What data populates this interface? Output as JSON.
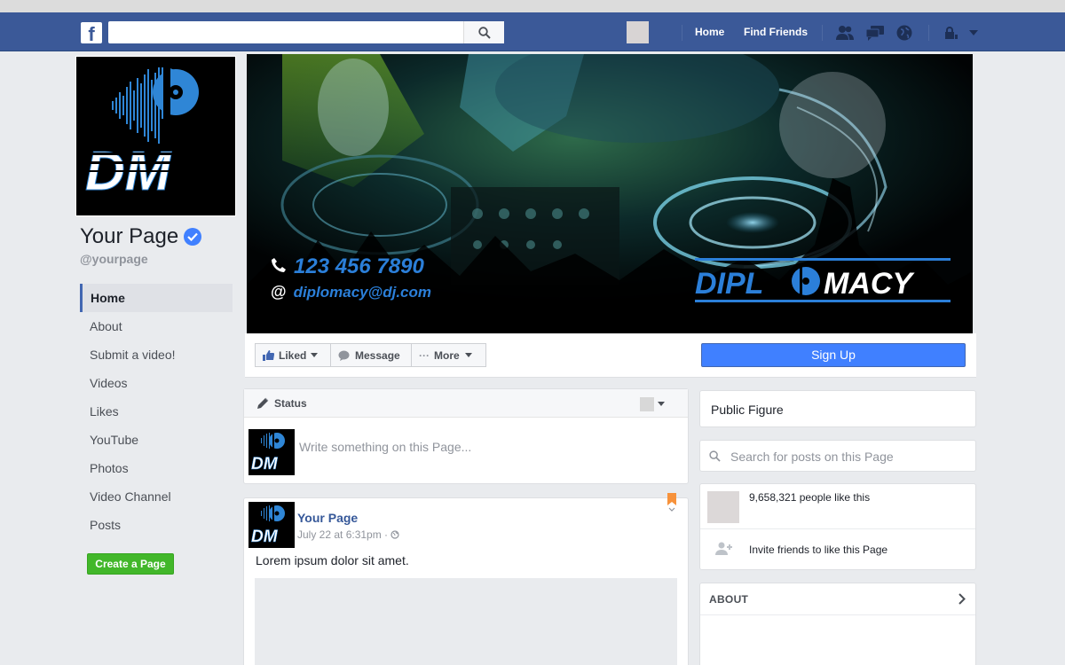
{
  "header": {
    "logo_letter": "f",
    "search_placeholder": "",
    "nav": [
      "Home",
      "Find Friends"
    ]
  },
  "page": {
    "name": "Your Page",
    "handle": "@yourpage"
  },
  "profile_logo": {
    "text": "DM"
  },
  "side_nav": [
    "Home",
    "About",
    "Submit a video!",
    "Videos",
    "Likes",
    "YouTube",
    "Photos",
    "Video Channel",
    "Posts"
  ],
  "create_page": "Create a Page",
  "cover": {
    "phone": "123 456 7890",
    "email": "diplomacy@dj.com",
    "brand_left": "DIPL",
    "brand_right": "MACY"
  },
  "actions": {
    "liked": "Liked",
    "message": "Message",
    "more": "More",
    "signup": "Sign Up"
  },
  "composer": {
    "status": "Status",
    "placeholder": "Write something on this Page..."
  },
  "post": {
    "author": "Your Page",
    "date": "July 22 at 6:31pm · ",
    "text": "Lorem ipsum dolor sit amet."
  },
  "right": {
    "category": "Public Figure",
    "search_placeholder": "Search for posts on this Page",
    "likes": "9,658,321 people like this",
    "invite": "Invite friends to like this Page",
    "about": "ABOUT"
  },
  "colors": {
    "header_bg": "#3b5998",
    "brand_blue": "#2b7fd9",
    "signup": "#4080ff",
    "create_page": "#42b72a"
  }
}
